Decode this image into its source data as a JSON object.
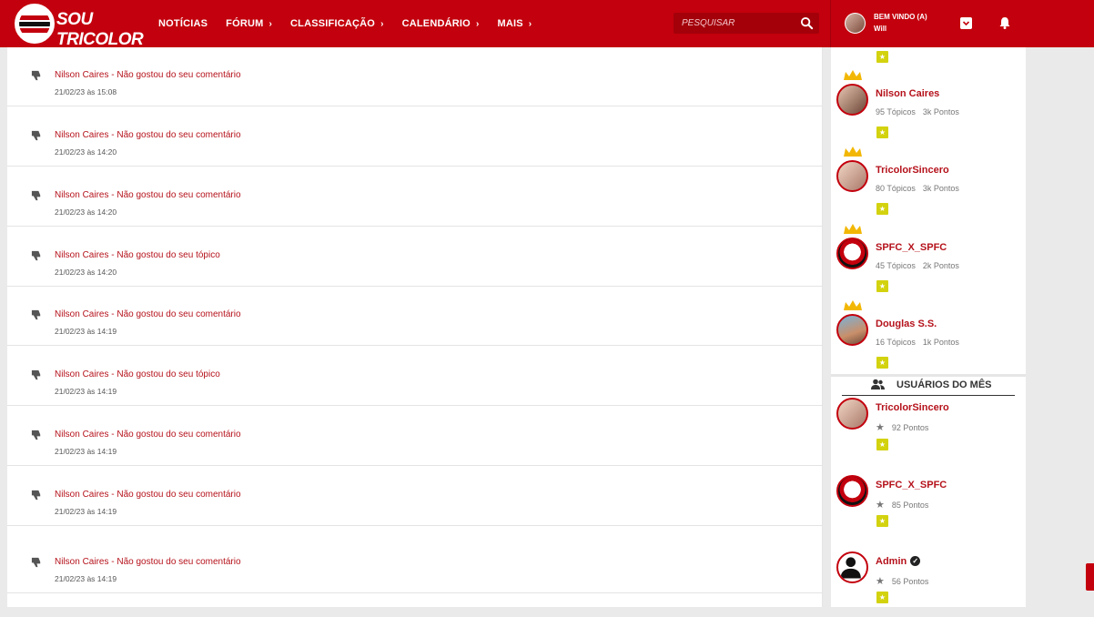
{
  "header": {
    "logo_text": "SOU TRICOLOR",
    "nav": [
      {
        "label": "NOTÍCIAS",
        "has_submenu": false
      },
      {
        "label": "FÓRUM",
        "has_submenu": true
      },
      {
        "label": "CLASSIFICAÇÃO",
        "has_submenu": true
      },
      {
        "label": "CALENDÁRIO",
        "has_submenu": true
      },
      {
        "label": "MAIS",
        "has_submenu": true
      }
    ],
    "search_placeholder": "PESQUISAR",
    "user": {
      "welcome": "BEM VINDO (A)",
      "name": "Will"
    }
  },
  "notifications": [
    {
      "text": "Nilson Caires - Não gostou do seu comentário",
      "time": "21/02/23 às 15:08"
    },
    {
      "text": "Nilson Caires - Não gostou do seu comentário",
      "time": "21/02/23 às 14:20"
    },
    {
      "text": "Nilson Caires - Não gostou do seu comentário",
      "time": "21/02/23 às 14:20"
    },
    {
      "text": "Nilson Caires - Não gostou do seu tópico",
      "time": "21/02/23 às 14:20"
    },
    {
      "text": "Nilson Caires - Não gostou do seu comentário",
      "time": "21/02/23 às 14:19"
    },
    {
      "text": "Nilson Caires - Não gostou do seu tópico",
      "time": "21/02/23 às 14:19"
    },
    {
      "text": "Nilson Caires - Não gostou do seu comentário",
      "time": "21/02/23 às 14:19"
    },
    {
      "text": "Nilson Caires - Não gostou do seu comentário",
      "time": "21/02/23 às 14:19"
    },
    {
      "text": "Nilson Caires - Não gostou do seu comentário",
      "time": "21/02/23 às 14:19"
    }
  ],
  "top_users": [
    {
      "name": "Nilson Caires",
      "topics": "95 Tópicos",
      "points": "3k Pontos"
    },
    {
      "name": "TricolorSincero",
      "topics": "80 Tópicos",
      "points": "3k Pontos"
    },
    {
      "name": "SPFC_X_SPFC",
      "topics": "45 Tópicos",
      "points": "2k Pontos"
    },
    {
      "name": "Douglas S.S.",
      "topics": "16 Tópicos",
      "points": "1k Pontos"
    }
  ],
  "month_section_title": "USUÁRIOS DO MÊS",
  "month_users": [
    {
      "name": "TricolorSincero",
      "points": "92 Pontos",
      "verified": false
    },
    {
      "name": "SPFC_X_SPFC",
      "points": "85 Pontos",
      "verified": false
    },
    {
      "name": "Admin",
      "points": "56 Pontos",
      "verified": true
    }
  ],
  "badge_glyph": "★",
  "colors": {
    "brand_red": "#c3000d",
    "link_red": "#b5121b",
    "badge_yellow": "#d3d20f"
  }
}
